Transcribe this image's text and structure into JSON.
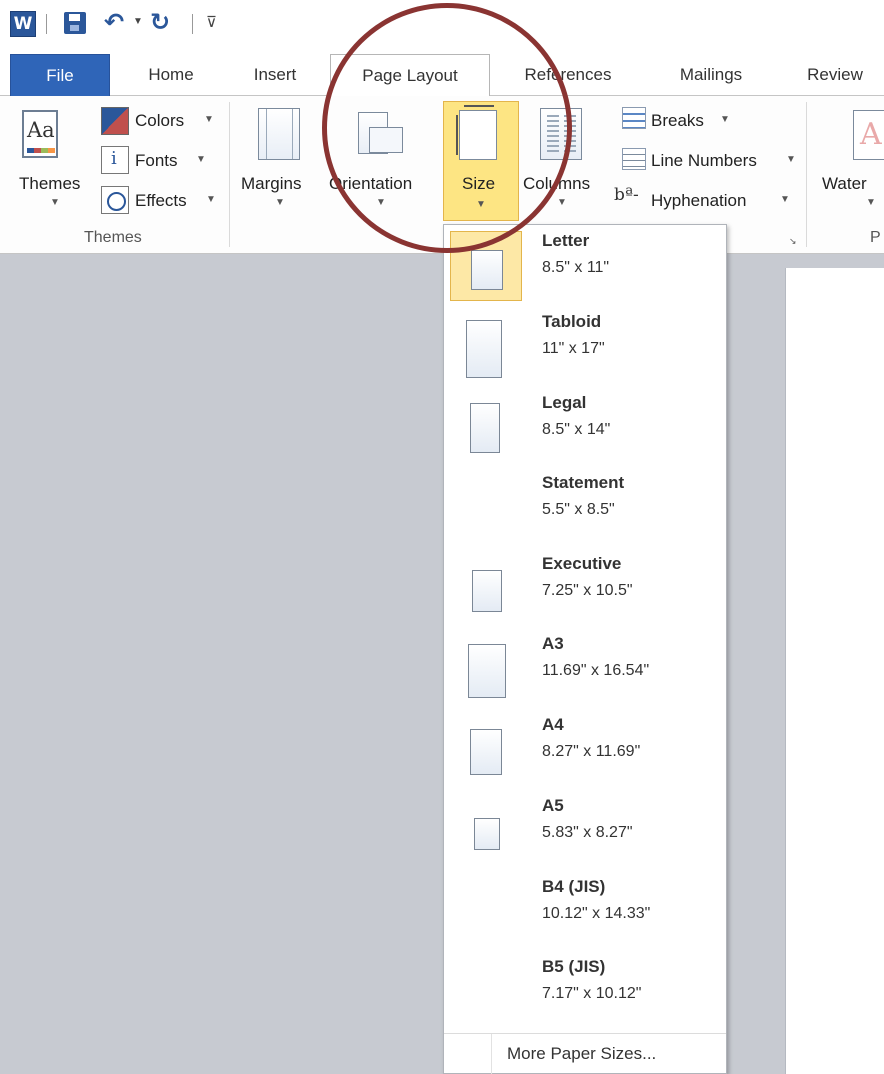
{
  "quick_access": {
    "app_icon": "W",
    "save_icon": "save-icon",
    "undo_glyph": "↶",
    "redo_glyph": "↻",
    "customize_glyph": "⊽"
  },
  "tabs": [
    {
      "label": "File"
    },
    {
      "label": "Home"
    },
    {
      "label": "Insert"
    },
    {
      "label": "Page Layout"
    },
    {
      "label": "References"
    },
    {
      "label": "Mailings"
    },
    {
      "label": "Review"
    }
  ],
  "ribbon": {
    "themes": {
      "themes_label": "Themes",
      "colors_label": "Colors",
      "fonts_label": "Fonts",
      "effects_label": "Effects",
      "group_label": "Themes"
    },
    "page_setup": {
      "margins_label": "Margins",
      "orientation_label": "Orientation",
      "size_label": "Size",
      "columns_label": "Columns",
      "breaks_label": "Breaks",
      "line_numbers_label": "Line Numbers",
      "hyphenation_label": "Hyphenation",
      "hyph_glyph": "bª-"
    },
    "page_background": {
      "watermark_label": "Water",
      "group_label_partial": "P"
    }
  },
  "size_menu": {
    "items": [
      {
        "name": "Letter",
        "dims": "8.5\" x 11\"",
        "selected": true
      },
      {
        "name": "Tabloid",
        "dims": "11\" x 17\"",
        "selected": false
      },
      {
        "name": "Legal",
        "dims": "8.5\" x 14\"",
        "selected": false
      },
      {
        "name": "Statement",
        "dims": "5.5\" x 8.5\"",
        "selected": false
      },
      {
        "name": "Executive",
        "dims": "7.25\" x 10.5\"",
        "selected": false
      },
      {
        "name": "A3",
        "dims": "11.69\" x 16.54\"",
        "selected": false
      },
      {
        "name": "A4",
        "dims": "8.27\" x 11.69\"",
        "selected": false
      },
      {
        "name": "A5",
        "dims": "5.83\" x 8.27\"",
        "selected": false
      },
      {
        "name": "B4 (JIS)",
        "dims": "10.12\" x 14.33\"",
        "selected": false
      },
      {
        "name": "B5 (JIS)",
        "dims": "7.17\" x 10.12\"",
        "selected": false
      }
    ],
    "more_label": "More Paper Sizes..."
  },
  "colors": {
    "file_tab": "#2f65b8",
    "highlight": "#fde583",
    "annotation": "#8a3432",
    "workspace": "#c7cad1"
  }
}
